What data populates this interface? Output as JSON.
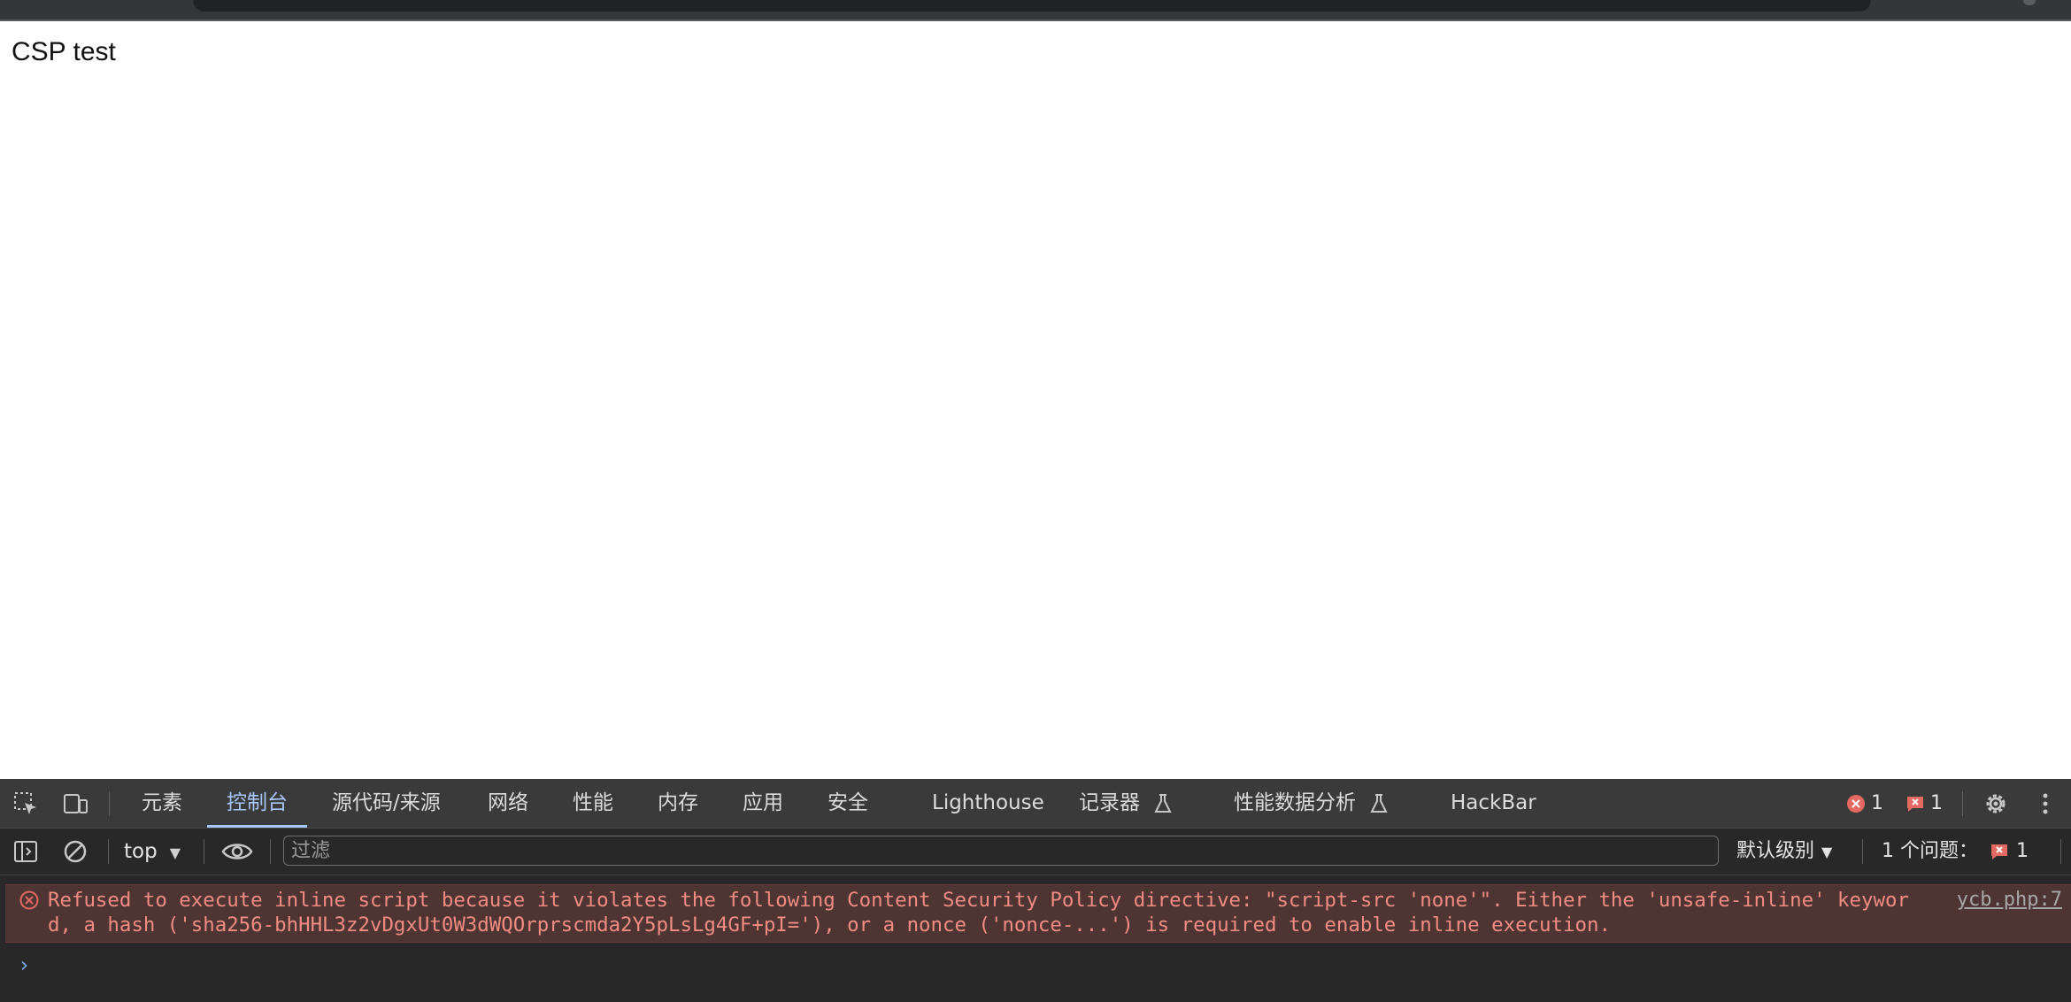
{
  "page": {
    "text": "CSP test"
  },
  "devtools": {
    "tabs": [
      {
        "label": "元素"
      },
      {
        "label": "控制台",
        "active": true
      },
      {
        "label": "源代码/来源"
      },
      {
        "label": "网络"
      },
      {
        "label": "性能"
      },
      {
        "label": "内存"
      },
      {
        "label": "应用"
      },
      {
        "label": "安全"
      },
      {
        "label": "Lighthouse"
      },
      {
        "label": "记录器"
      },
      {
        "label": "性能数据分析"
      },
      {
        "label": "HackBar"
      }
    ],
    "error_count": "1",
    "issue_count": "1",
    "toolbar": {
      "context": "top",
      "filter_placeholder": "过滤",
      "levels": "默认级别",
      "issues_label": "1 个问题：",
      "issues_count": "1"
    },
    "console": {
      "message": "Refused to execute inline script because it violates the following Content Security Policy directive: \"script-src 'none'\". Either the 'unsafe-inline' keyword, a hash ('sha256-bhHHL3z2vDgxUt0W3dWQOrprscmda2Y5pLsLg4GF+pI='), or a nonce ('nonce-...') is required to enable inline execution.",
      "source": "ycb.php:7",
      "prompt": "›"
    },
    "colors": {
      "error_text": "#f28b82",
      "error_bg": "#4e3534",
      "active_tab": "#a8c7fa"
    }
  }
}
